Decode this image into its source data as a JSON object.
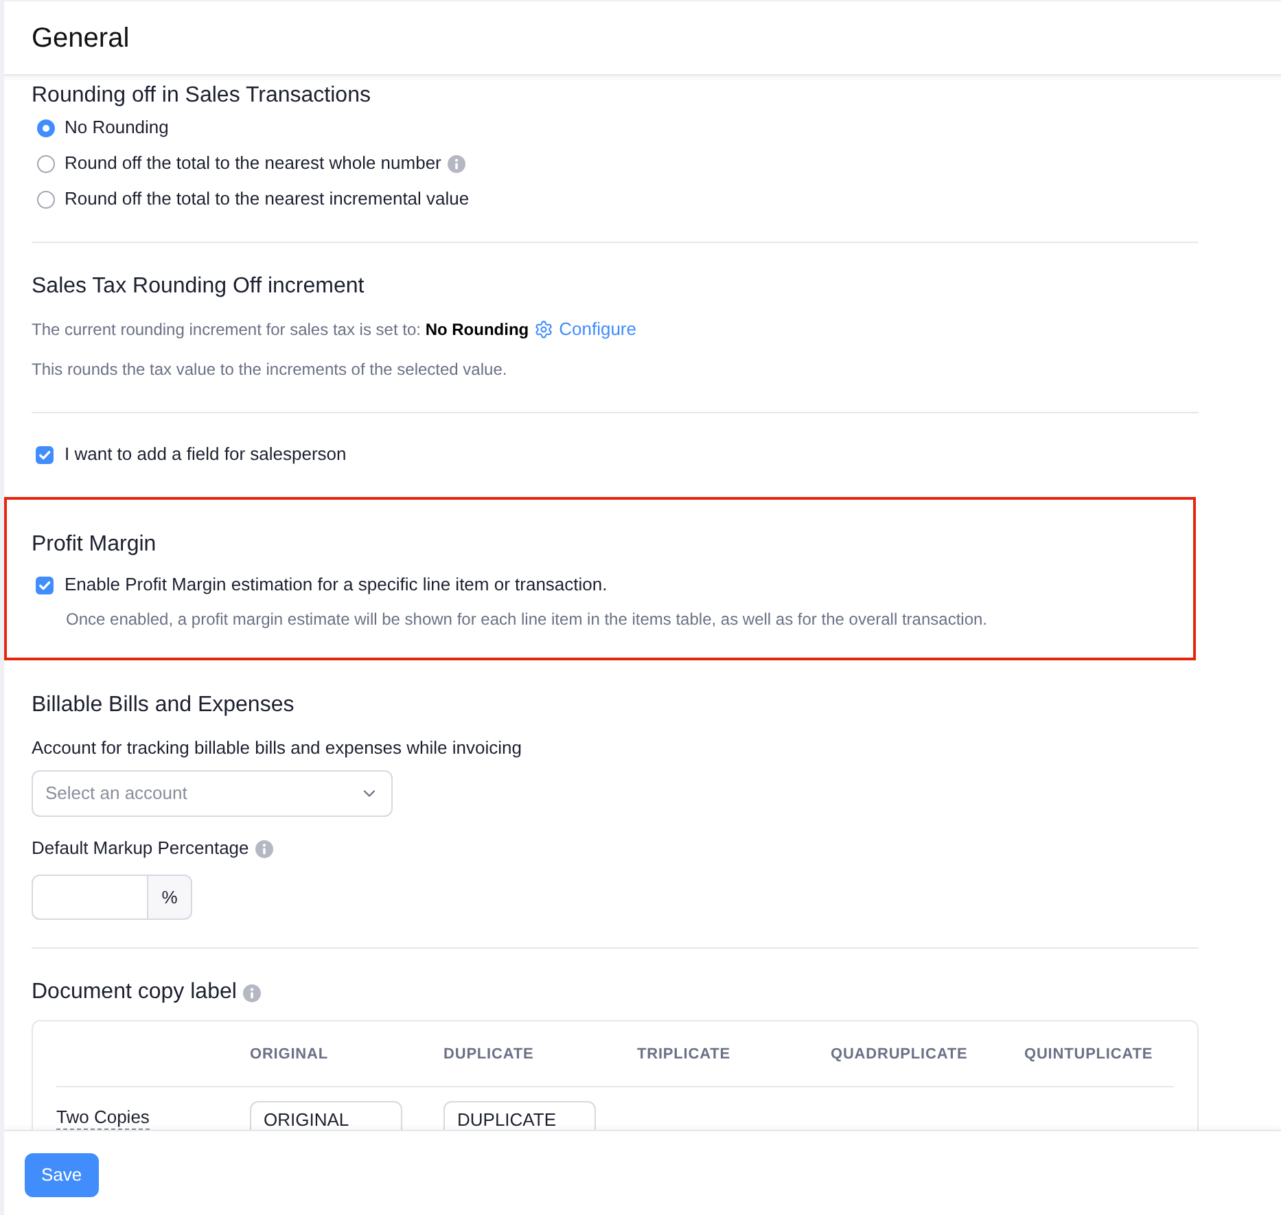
{
  "header": {
    "title": "General"
  },
  "rounding": {
    "title": "Rounding off in Sales Transactions",
    "options": [
      {
        "label": "No Rounding",
        "selected": true,
        "info": false
      },
      {
        "label": "Round off the total to the nearest whole number",
        "selected": false,
        "info": true
      },
      {
        "label": "Round off the total to the nearest incremental value",
        "selected": false,
        "info": false
      }
    ]
  },
  "sales_tax": {
    "title": "Sales Tax Rounding Off increment",
    "current_setting": "The current rounding increment for sales tax is set to: **No Rounding**",
    "configure_link": "Configure",
    "note": "This rounds the tax value to the increments of the selected value."
  },
  "salesperson": {
    "label": "I want to add a field for salesperson",
    "checked": true
  },
  "profit_margin": {
    "title": "Profit Margin",
    "highlighted": true,
    "enable": {
      "label": "Enable Profit Margin estimation for a specific line item or transaction.",
      "checked": true
    },
    "description": "Once enabled, a profit margin estimate will be shown for each line item in the items table, as well as for the overall transaction."
  },
  "billable": {
    "title": "Billable Bills and Expenses",
    "account_label": "Account for tracking billable bills and expenses while invoicing",
    "account_select": {
      "placeholder": "Select an account"
    },
    "markup_label": "Default Markup Percentage",
    "markup_suffix": "%"
  },
  "document_copy": {
    "title": "Document copy label",
    "columns": [
      "ORIGINAL",
      "DUPLICATE",
      "TRIPLICATE",
      "QUADRUPLICATE",
      "QUINTUPLICATE"
    ],
    "rows": [
      {
        "label": "Two Copies",
        "values": [
          "ORIGINAL",
          "DUPLICATE"
        ]
      }
    ]
  },
  "footer": {
    "save_button": "Save"
  }
}
